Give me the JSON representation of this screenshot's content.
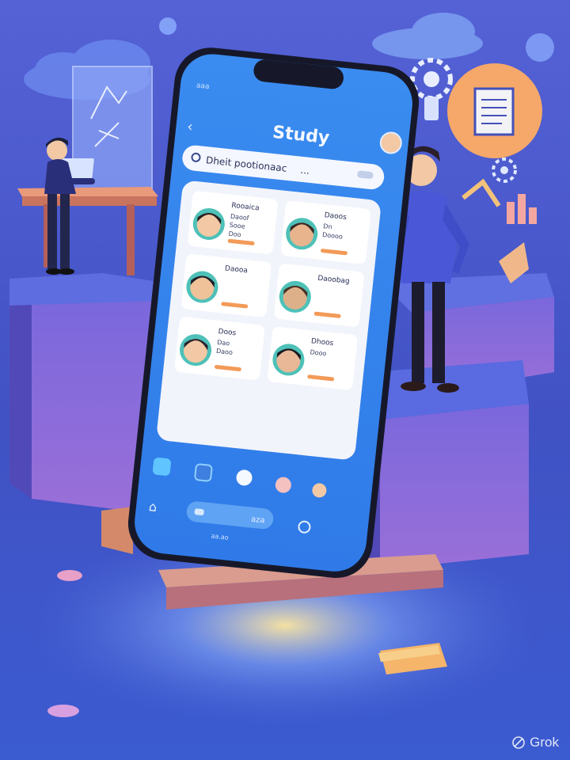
{
  "app": {
    "title": "Study",
    "search_text": "Dheit pootionaac",
    "search_suffix": "..."
  },
  "cards": [
    {
      "name": "Rooaica",
      "lines": [
        "Daoof",
        "Sooe",
        "Doo"
      ]
    },
    {
      "name": "Daoos",
      "lines": [
        "Dn",
        "Doooo"
      ]
    },
    {
      "name": "Daooa",
      "lines": []
    },
    {
      "name": "Daoobag",
      "lines": []
    },
    {
      "name": "Doos",
      "lines": [
        "Dao",
        "Daoo"
      ]
    },
    {
      "name": "Dhoos",
      "lines": [
        "Dooo"
      ]
    }
  ],
  "bottom_bar": {
    "pill_text": "aza",
    "footer_text": "aa.ao"
  },
  "watermark": "Grok",
  "colors": {
    "background": "#4553c8",
    "phone_screen": "#3c8ef0",
    "card_panel": "#f2f4fb",
    "accent_orange": "#f39a58"
  }
}
